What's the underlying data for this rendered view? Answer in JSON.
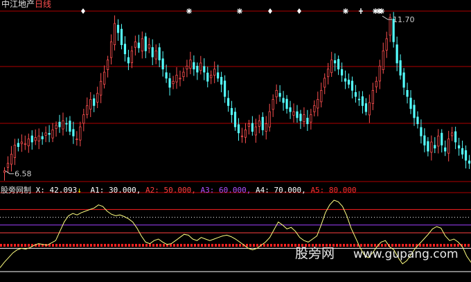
{
  "header": {
    "stock_name": "中江地产",
    "period": "日线"
  },
  "indicator": {
    "name": "股旁网制",
    "x_label": "X:",
    "x_value": "42.093",
    "x_arrow": "↓",
    "a1": "A1: 30.000,",
    "a2": "A2: 50.000,",
    "a3": "A3: 60.000,",
    "a4": "A4: 70.000,",
    "a5": "A5: 80.000"
  },
  "watermark": {
    "site_cn": "股旁网",
    "site_url": "www.gupang.com"
  },
  "colors": {
    "background": "#000000",
    "up_candle": "#ff5050",
    "down_candle": "#54ffff",
    "grid_red": "#b00000",
    "indicator_line": "#ffff80",
    "a1_line": "#ffffff",
    "a2_line": "#ff4040",
    "a3_line": "#a040ff",
    "a4_line": "#ffffff",
    "a5_line": "#ff2020",
    "dotted_band": "#ff2020"
  },
  "chart_data": [
    {
      "type": "candlestick",
      "title": "中江地产 日线",
      "annotations": [
        {
          "label": "11.70",
          "type": "high"
        },
        {
          "label": "6.58",
          "type": "low"
        }
      ],
      "ylim": [
        6.3,
        12.0
      ],
      "signal_markers": [
        "diamond",
        "star",
        "star",
        "diamond",
        "diamond",
        "star",
        "cross",
        "star",
        "star",
        "star"
      ],
      "close_series": [
        6.65,
        6.9,
        7.2,
        7.5,
        7.45,
        7.6,
        7.55,
        7.7,
        7.6,
        7.75,
        7.8,
        7.7,
        7.9,
        7.85,
        8.0,
        8.15,
        8.1,
        8.3,
        8.2,
        7.95,
        7.8,
        7.7,
        8.1,
        8.5,
        8.8,
        9.0,
        8.8,
        9.2,
        9.6,
        9.9,
        10.3,
        10.9,
        11.5,
        11.2,
        10.8,
        10.5,
        10.2,
        10.6,
        10.9,
        10.7,
        11.0,
        10.6,
        10.8,
        10.4,
        10.6,
        10.3,
        10.0,
        9.7,
        9.4,
        9.6,
        9.8,
        9.7,
        9.9,
        10.1,
        10.3,
        10.0,
        9.9,
        10.2,
        9.9,
        9.6,
        9.8,
        10.0,
        9.7,
        9.5,
        9.1,
        8.8,
        8.5,
        8.1,
        7.9,
        7.8,
        8.0,
        8.2,
        7.95,
        8.1,
        8.3,
        8.0,
        8.2,
        8.6,
        9.0,
        9.3,
        9.1,
        8.9,
        8.7,
        8.6,
        8.6,
        8.4,
        8.3,
        8.5,
        8.2,
        8.5,
        8.8,
        9.0,
        9.3,
        9.7,
        10.0,
        10.3,
        10.2,
        10.0,
        9.8,
        9.6,
        9.5,
        9.3,
        9.1,
        9.0,
        8.8,
        8.6,
        8.9,
        9.3,
        9.6,
        10.1,
        10.6,
        11.0,
        11.7,
        10.9,
        10.2,
        9.8,
        9.4,
        9.1,
        8.7,
        8.4,
        8.2,
        7.8,
        7.5,
        7.3,
        7.6,
        7.4,
        7.8,
        7.5,
        7.3,
        7.7,
        7.9,
        7.6,
        7.4,
        7.2,
        7.0,
        6.9
      ]
    },
    {
      "type": "line",
      "title": "股旁网制",
      "series": [
        {
          "name": "X",
          "values": [
            5,
            12,
            18,
            24,
            28,
            30,
            29,
            31,
            34,
            36,
            35,
            34,
            37,
            40,
            52,
            64,
            72,
            75,
            73,
            76,
            78,
            80,
            82,
            86,
            84,
            78,
            74,
            72,
            73,
            71,
            68,
            64,
            56,
            46,
            38,
            36,
            40,
            42,
            38,
            35,
            36,
            40,
            44,
            48,
            47,
            42,
            40,
            44,
            42,
            40,
            42,
            44,
            46,
            47,
            45,
            42,
            38,
            34,
            30,
            28,
            30,
            34,
            38,
            44,
            54,
            64,
            60,
            55,
            57,
            52,
            44,
            40,
            38,
            42,
            46,
            60,
            76,
            86,
            92,
            90,
            84,
            72,
            56,
            44,
            32,
            22,
            18,
            24,
            32,
            38,
            40,
            32,
            28,
            18,
            10,
            14,
            22,
            30,
            36,
            42,
            48,
            55,
            58,
            56,
            46,
            40,
            42,
            38,
            32,
            20,
            12
          ]
        }
      ],
      "reference_lines": [
        {
          "name": "A1",
          "value": 30
        },
        {
          "name": "A2",
          "value": 50
        },
        {
          "name": "A3",
          "value": 60
        },
        {
          "name": "A4",
          "value": 70
        },
        {
          "name": "A5",
          "value": 80
        }
      ],
      "ylim": [
        0,
        100
      ]
    }
  ]
}
